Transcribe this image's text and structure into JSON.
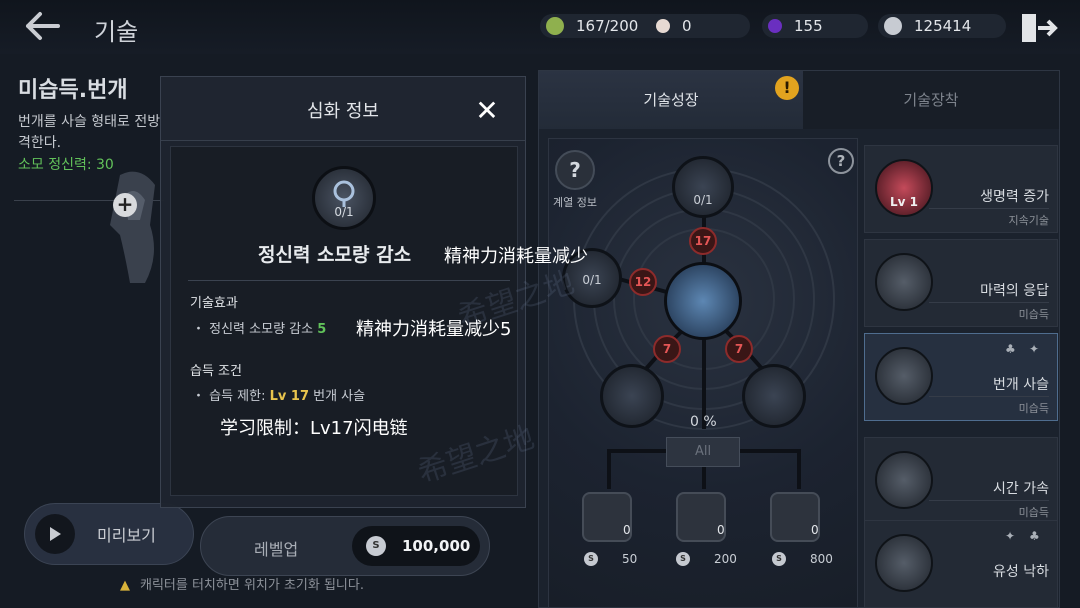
{
  "header": {
    "title": "기술",
    "resources": [
      {
        "icon": "stamina-icon",
        "value": "167/200",
        "color": "#9bbf5a"
      },
      {
        "icon": "pearl-icon",
        "value": "0",
        "color": "#e6d9d2"
      },
      {
        "icon": "purple-gem-icon",
        "value": "155",
        "color": "#7a3bd1"
      },
      {
        "icon": "silver-coin-icon",
        "value": "125414",
        "color": "#c7cbd2"
      }
    ]
  },
  "background_skill": {
    "name": "미습득.번개",
    "description": "번개를 사슬 형태로 전방의 적들에게 연쇄 시켜 타격한다.",
    "cost": "소모 정신력: 30",
    "preview_label": "미리보기",
    "warning": "캐릭터를 터치하면 위치가 초기화 됩니다."
  },
  "right_panel": {
    "tabs": [
      "기술성장",
      "기술장착"
    ],
    "tree_info_label": "계열 정보",
    "percent": "0 %",
    "all_label": "All",
    "nodes": {
      "top": "0/1",
      "left": "0/1",
      "req_top": "17",
      "req_left": "12",
      "req_bottom_left": "7",
      "req_bottom_right": "7"
    },
    "books": [
      {
        "count": "0",
        "cost": "50"
      },
      {
        "count": "0",
        "cost": "200"
      },
      {
        "count": "0",
        "cost": "800"
      }
    ],
    "skill_list": [
      {
        "icon_text": "Lv 1",
        "title": "생명력 증가",
        "sub": "지속기술"
      },
      {
        "icon_text": "",
        "title": "마력의 응답",
        "sub": "미습득"
      },
      {
        "icon_text": "",
        "title": "번개 사슬",
        "sub": "미습득"
      },
      {
        "icon_text": "",
        "title": "시간 가속",
        "sub": "미습득"
      },
      {
        "icon_text": "",
        "title": "유성 낙하",
        "sub": ""
      }
    ]
  },
  "modal": {
    "title": "심화 정보",
    "node_progress": "0/1",
    "skill_name": "정신력 소모량 감소",
    "skill_name_cn": "精神力消耗量减少",
    "effect_header": "기술효과",
    "effect_prefix": "・ 정신력 소모량 감소 ",
    "effect_value": "5",
    "effect_cn": "精神力消耗量减少5",
    "req_header": "습득 조건",
    "req_prefix": "・ 습득 제한: ",
    "req_level": "Lv 17",
    "req_suffix": " 번개 사슬",
    "req_cn": "学习限制：Lv17闪电链",
    "watermark": "希望之地",
    "levelup_label": "레벨업",
    "levelup_cost": "100,000"
  }
}
